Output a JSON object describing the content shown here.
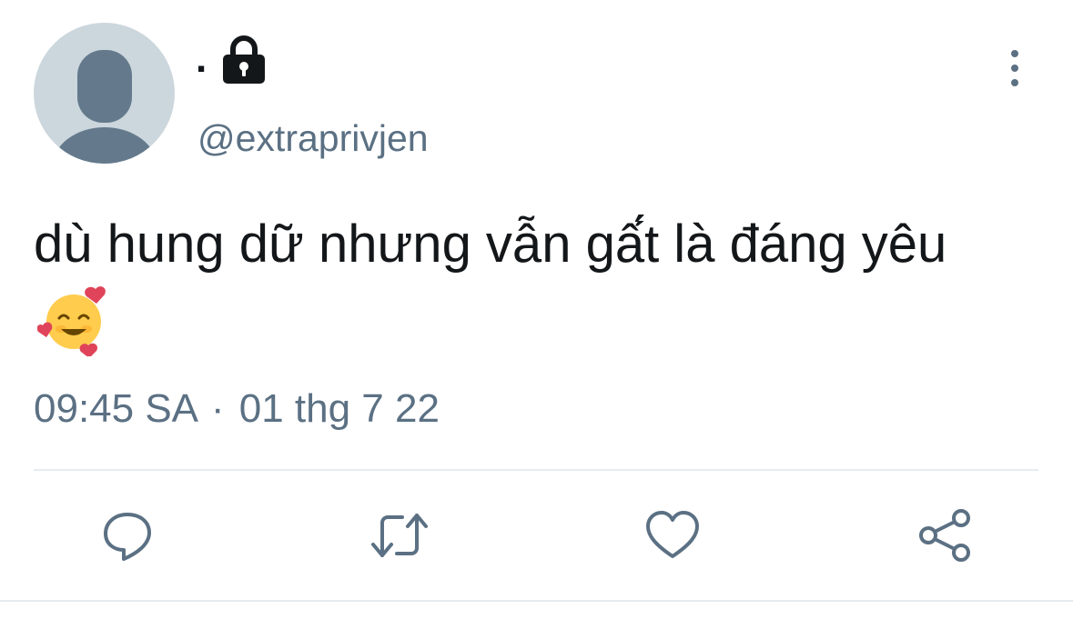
{
  "tweet": {
    "display_name": ".",
    "handle": "@extraprivjen",
    "text": "dù hung dữ nhưng vẫn gấ́t là đáng yêu",
    "emoji": "🥰",
    "time": "09:45 SA",
    "separator": "·",
    "date": "01 thg 7 22"
  },
  "icons": {
    "avatar": "default-avatar-icon",
    "lock": "lock-icon",
    "more": "more-vertical-icon",
    "reply": "reply-icon",
    "retweet": "retweet-icon",
    "like": "heart-icon",
    "share": "share-icon"
  },
  "colors": {
    "text_primary": "#14171a",
    "text_secondary": "#5b7083",
    "avatar_bg": "#ccd6dd",
    "avatar_fg": "#647a8c",
    "divider": "#e6ecf0"
  }
}
